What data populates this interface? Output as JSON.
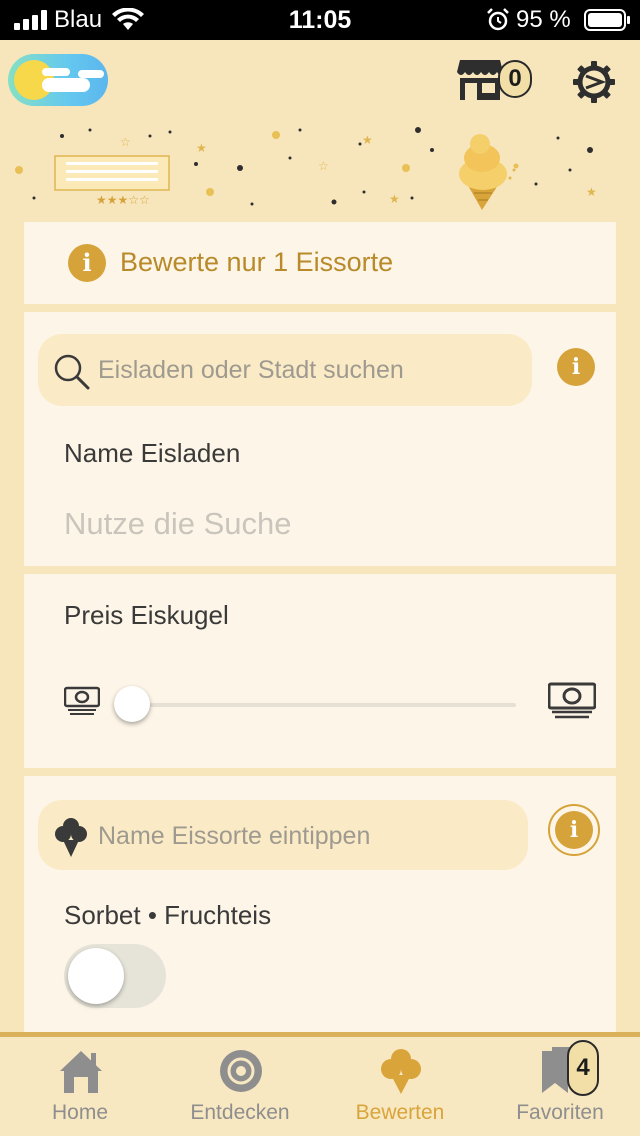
{
  "status_bar": {
    "carrier": "Blau",
    "time": "11:05",
    "battery_percent": "95 %"
  },
  "header": {
    "shop_count": "0"
  },
  "hint_card": {
    "text": "Bewerte nur 1 Eissorte",
    "icon": "info-icon"
  },
  "search_card": {
    "search_placeholder": "Eisladen oder Stadt suchen",
    "name_label": "Name Eisladen",
    "name_placeholder": "Nutze die Suche"
  },
  "price_card": {
    "label": "Preis Eiskugel",
    "slider_value_fraction": 0
  },
  "flavor_card": {
    "flavor_placeholder": "Name Eissorte eintippen",
    "sorbet_label": "Sorbet • Fruchteis",
    "sorbet_enabled": false
  },
  "tabbar": {
    "tabs": [
      {
        "label": "Home",
        "icon": "house-icon"
      },
      {
        "label": "Entdecken",
        "icon": "target-icon"
      },
      {
        "label": "Bewerten",
        "icon": "ice-cream-icon"
      },
      {
        "label": "Favoriten",
        "icon": "bookmark-icon"
      }
    ],
    "active": "Bewerten",
    "favorites_count": "4"
  },
  "colors": {
    "background": "#f7e6bc",
    "card": "#fdf5e7",
    "accent": "#d6a33a",
    "hint_text": "#b88a2a"
  }
}
